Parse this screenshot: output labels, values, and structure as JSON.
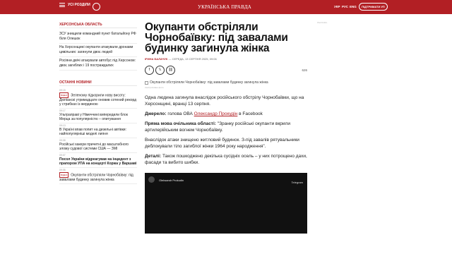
{
  "topbar": {
    "menu_label": "УСІ РОЗДІЛИ",
    "logo": "УКРАЇНСЬКА ПРАВДА",
    "languages": [
      "УКР",
      "РУС",
      "ENG"
    ],
    "support_label": "ПІДТРИМАТИ УП"
  },
  "region": {
    "heading": "ХЕРСОНСЬКА ОБЛАСТЬ",
    "items": [
      "ЗСУ знищили командний пункт батальйону РФ біля Олешок",
      "На Херсонщині окупанти атакували дронами цивільних: загинули двоє людей",
      "Росіяни двічі атакували автобус під Херсоном: двоє загиблих і 19 постраждалих"
    ]
  },
  "latest": {
    "heading": "ОСТАННІ НОВИНИ",
    "video_tag": "ВІДЕО",
    "items": [
      {
        "time": "09:15",
        "title": "Зеленому підкорили нову висоту: Дюпіанскі утримадцате оновив сотений рекорд у стрибках із жердиною"
      },
      {
        "time": "09:17",
        "title": "Ультраправі у Німеччині випередили блок Мерца за популярністю – опитування"
      },
      {
        "time": "09:13",
        "title": "В Україні впав попит на дизельні автівки: найпопулярніші моделі липня"
      },
      {
        "time": "09:08",
        "title": "Російські хакери причетні до масштабного злому судової системи США — ЗМІ"
      },
      {
        "time": "09:07",
        "title": "Посол України відреагував на інцидент з прапором УПА на концерті Коржа у Варшаві"
      },
      {
        "time": "09:06",
        "title": "Окупанти обстріляли Чорнобаївку: під завалами будинку загинула жінка"
      }
    ]
  },
  "article": {
    "title": "Окупанти обстріляли Чорнобаївку: під завалами будинку загинула жінка",
    "author": "ІРИНА БАЛАЧУК",
    "date": " — СЕРЕДА, 13 СЕРПНЯ 2025, 09:06",
    "share_icons": [
      "facebook-icon",
      "x-icon",
      "link-icon"
    ],
    "views": "626",
    "photo_caption": "Окупанти обстріляли Чорнобаївку: під завалами будинку загинула жінка",
    "photo_credit": "ілюстративне фото",
    "p1": "Одна людина загинула внаслідок російського обстрілу Чорнобаївки, що на Херсонщині, вранці 13 серпня.",
    "p2_label": "Джерело:",
    "p2_text": " голова ОВА ",
    "p2_link": "Олександр Прокудін",
    "p2_after": " в Facebook",
    "p3_label": "Пряма мова очільника області:",
    "p3_text": " \"Зранку російські окупанти вкрили артилерійським вогнем Чорнобаївку.",
    "p4": "Внаслідок атаки знищено житловий будинок. З-під завалів рятувальники деблокували тіло загиблої жінки 1964 року народження\".",
    "p5_label": "Деталі:",
    "p5_text": " Також пошкоджено декілька сусідніх осель – у них потрощено дахи, фасади та вибито шибки."
  },
  "video": {
    "channel": "Oleksandr Prokudin",
    "brand": "Telegram"
  },
  "ad_label": "РЕКЛАМА"
}
